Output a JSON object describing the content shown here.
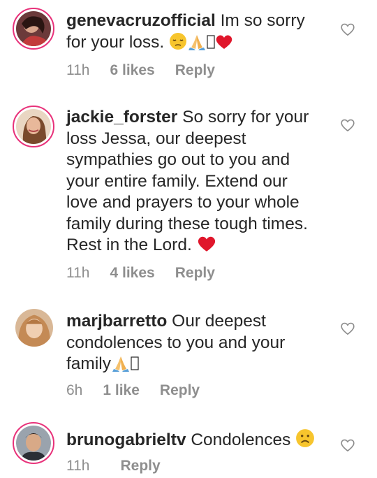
{
  "comments": [
    {
      "username": "genevacruzofficial",
      "text": "Im so sorry for your loss.",
      "emojis": [
        "pensive-face",
        "folded-hands",
        "missing-glyph",
        "red-heart"
      ],
      "time": "11h",
      "likes": "6 likes",
      "reply": "Reply"
    },
    {
      "username": "jackie_forster",
      "text": "So sorry for your loss Jessa, our deepest sympathies go out to you and your entire family. Extend our love and prayers to your whole family during these tough times. Rest in the Lord.",
      "emojis": [
        "red-heart"
      ],
      "time": "11h",
      "likes": "4 likes",
      "reply": "Reply"
    },
    {
      "username": "marjbarretto",
      "text": "Our deepest condolences to you and your family",
      "emojis": [
        "folded-hands",
        "missing-glyph"
      ],
      "time": "6h",
      "likes": "1 like",
      "reply": "Reply"
    },
    {
      "username": "brunogabrieltv",
      "text": "Condolences",
      "emojis": [
        "frowning-face"
      ],
      "time": "11h",
      "likes": "",
      "reply": "Reply"
    }
  ]
}
